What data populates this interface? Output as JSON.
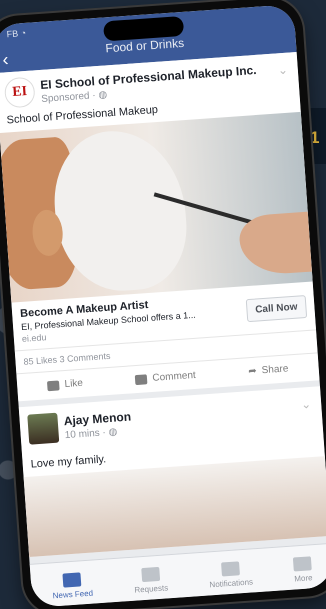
{
  "statusbar": {
    "carrier": "FB"
  },
  "header": {
    "title": "Food or Drinks"
  },
  "sponsored_post": {
    "logo_text": "EI",
    "author": "EI School of Professional Makeup Inc.",
    "meta": "Sponsored · ",
    "text": "School of Professional Makeup",
    "ad_title": "Become A Makeup Artist",
    "ad_subtitle": "EI, Professional Makeup School offers a 1...",
    "ad_domain": "ei.edu",
    "cta_label": "Call Now",
    "stats": "85 Likes  3 Comments"
  },
  "actions": {
    "like": "Like",
    "comment": "Comment",
    "share": "Share"
  },
  "second_post": {
    "author": "Ajay Menon",
    "meta": "10 mins · ",
    "text": "Love my family."
  },
  "tabbar": {
    "news_feed": "News Feed",
    "requests": "Requests",
    "notifications": "Notifications",
    "more": "More"
  },
  "colors": {
    "brand": "#3b5998",
    "active_tab": "#4267b2"
  }
}
